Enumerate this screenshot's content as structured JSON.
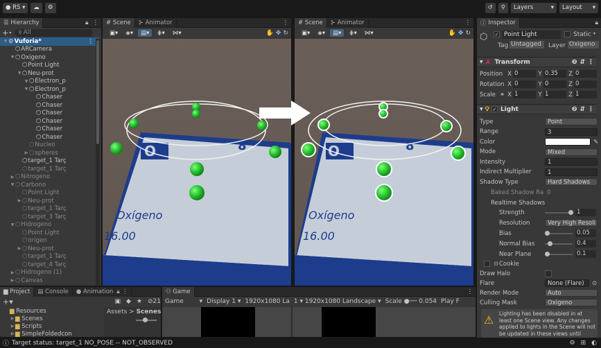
{
  "toolbar": {
    "account": "RS",
    "layers": "Layers",
    "layout": "Layout"
  },
  "hierarchy": {
    "tab": "Hierarchy",
    "search_placeholder": "All",
    "items": [
      {
        "label": "Vuforia*",
        "indent": 0,
        "bold": true,
        "dim": false
      },
      {
        "label": "ARCamera",
        "indent": 1,
        "dim": false
      },
      {
        "label": "Oxigeno",
        "indent": 1,
        "dim": false
      },
      {
        "label": "Point Light",
        "indent": 2,
        "dim": false
      },
      {
        "label": "Neu-prot",
        "indent": 2,
        "dim": false
      },
      {
        "label": "Electron_p",
        "indent": 3,
        "dim": false
      },
      {
        "label": "Electron_p",
        "indent": 3,
        "dim": false
      },
      {
        "label": "Chaser",
        "indent": 4,
        "dim": false
      },
      {
        "label": "Chaser",
        "indent": 4,
        "dim": false
      },
      {
        "label": "Chaser",
        "indent": 4,
        "dim": false
      },
      {
        "label": "Chaser",
        "indent": 4,
        "dim": false
      },
      {
        "label": "Chaser",
        "indent": 4,
        "dim": false
      },
      {
        "label": "Chaser",
        "indent": 4,
        "dim": false
      },
      {
        "label": "Nucleo",
        "indent": 3,
        "dim": true
      },
      {
        "label": "spheres",
        "indent": 3,
        "dim": true
      },
      {
        "label": "target_1 Tarç",
        "indent": 2,
        "dim": false
      },
      {
        "label": "target_1 Tarç",
        "indent": 2,
        "dim": true
      },
      {
        "label": "Nitrogeno",
        "indent": 1,
        "dim": true
      },
      {
        "label": "Carbono",
        "indent": 1,
        "dim": true
      },
      {
        "label": "Point Light",
        "indent": 2,
        "dim": true
      },
      {
        "label": "Neu-prot",
        "indent": 2,
        "dim": true
      },
      {
        "label": "target_1 Tarç",
        "indent": 2,
        "dim": true
      },
      {
        "label": "target_3 Tarç",
        "indent": 2,
        "dim": true
      },
      {
        "label": "Hidrogeno",
        "indent": 1,
        "dim": true
      },
      {
        "label": "Point Light",
        "indent": 2,
        "dim": true
      },
      {
        "label": "origen",
        "indent": 2,
        "dim": true
      },
      {
        "label": "Neu-prot",
        "indent": 2,
        "dim": true
      },
      {
        "label": "target_1 Tarç",
        "indent": 2,
        "dim": true
      },
      {
        "label": "target_4 Tarç",
        "indent": 2,
        "dim": true
      },
      {
        "label": "Hidrogeno (1)",
        "indent": 1,
        "dim": true
      },
      {
        "label": "Canvas",
        "indent": 1,
        "dim": true
      }
    ]
  },
  "scene_tabs": {
    "scene": "Scene",
    "animator": "Animator"
  },
  "scene_labels": {
    "element": "Oxígeno",
    "mass": "16.00",
    "num_left": "O",
    "num_right": "8"
  },
  "inspector": {
    "tab": "Inspector",
    "object_name": "Point Light",
    "static_label": "Static",
    "tag_label": "Tag",
    "tag_value": "Untagged",
    "layer_label": "Layer",
    "layer_value": "Oxigeno",
    "transform": {
      "title": "Transform",
      "position_label": "Position",
      "position": {
        "x": "0",
        "y": "0.35",
        "z": "0"
      },
      "rotation_label": "Rotation",
      "rotation": {
        "x": "0",
        "y": "0",
        "z": "0"
      },
      "scale_label": "Scale",
      "scale": {
        "x": "1",
        "y": "1",
        "z": "1"
      }
    },
    "light": {
      "title": "Light",
      "rows": [
        {
          "label": "Type",
          "value": "Point",
          "kind": "dd"
        },
        {
          "label": "Range",
          "value": "3",
          "kind": "field"
        },
        {
          "label": "Color",
          "value": "",
          "kind": "color"
        },
        {
          "label": "Mode",
          "value": "Mixed",
          "kind": "dd"
        },
        {
          "label": "Intensity",
          "value": "1",
          "kind": "field"
        },
        {
          "label": "Indirect Multiplier",
          "value": "1",
          "kind": "field"
        },
        {
          "label": "Shadow Type",
          "value": "Hard Shadows",
          "kind": "dd"
        }
      ],
      "baked_shadow_label": "Baked Shadow Ra",
      "baked_shadow_value": "0",
      "realtime_shadows": "Realtime Shadows",
      "strength_label": "Strength",
      "strength_value": "1",
      "resolution_label": "Resolution",
      "resolution_value": "Very High Resoli",
      "bias_label": "Bias",
      "bias_value": "0.05",
      "normal_bias_label": "Normal Bias",
      "normal_bias_value": "0.4",
      "near_plane_label": "Near Plane",
      "near_plane_value": "0.1",
      "cookie_label": "Cookie",
      "draw_halo_label": "Draw Halo",
      "flare_label": "Flare",
      "flare_value": "None (Flare)",
      "render_mode_label": "Render Mode",
      "render_mode_value": "Auto",
      "culling_mask_label": "Culling Mask",
      "culling_mask_value": "Oxigeno",
      "warning": "Lighting has been disabled in at least one Scene view. Any changes applied to lights in the Scene will not be updated in these views until Lighting"
    }
  },
  "bottom": {
    "tabs": {
      "project": "Project",
      "console": "Console",
      "animation": "Animation",
      "game": "Game"
    },
    "folders": [
      "Resources",
      "Scenes",
      "Scripts",
      "SimpleFoldedcon"
    ],
    "breadcrumb_assets": "Assets",
    "breadcrumb_scenes": "Scenes",
    "anim_count": "21",
    "game_label": "Game",
    "display": "Display 1",
    "resolution1": "1920x1080 La",
    "resolution2": "1920x1080 Landscape",
    "scale_label": "Scale",
    "scale_value": "0.054",
    "play_label": "Play F"
  },
  "status": {
    "text": "Target status: target_1 NO_POSE -- NOT_OBSERVED"
  },
  "colors": {
    "selection": "#2c5d87",
    "sphere": "#2fcf3a",
    "board": "#c7cfd8",
    "board_border": "#1d3c8c"
  }
}
